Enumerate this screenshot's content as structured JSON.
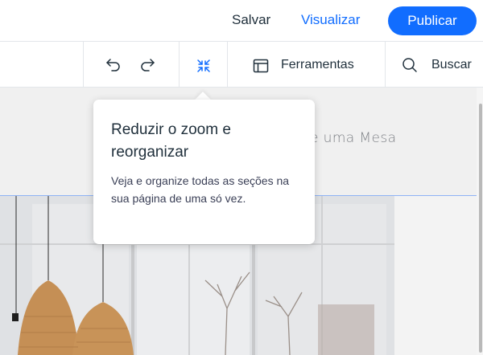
{
  "header": {
    "save_label": "Salvar",
    "preview_label": "Visualizar",
    "publish_label": "Publicar"
  },
  "toolbar": {
    "undo_icon": "undo-icon",
    "redo_icon": "redo-icon",
    "zoom_out_icon": "zoom-out-icon",
    "tools_icon": "tools-icon",
    "tools_label": "Ferramentas",
    "search_icon": "search-icon",
    "search_label": "Buscar"
  },
  "canvas": {
    "section_text": "e uma Mesa"
  },
  "tooltip": {
    "title": "Reduzir o zoom e reorganizar",
    "body": "Veja e organize todas as seções na sua página de uma só vez."
  },
  "colors": {
    "accent": "#116dff",
    "text": "#20303c",
    "border": "#e3e6ea"
  }
}
